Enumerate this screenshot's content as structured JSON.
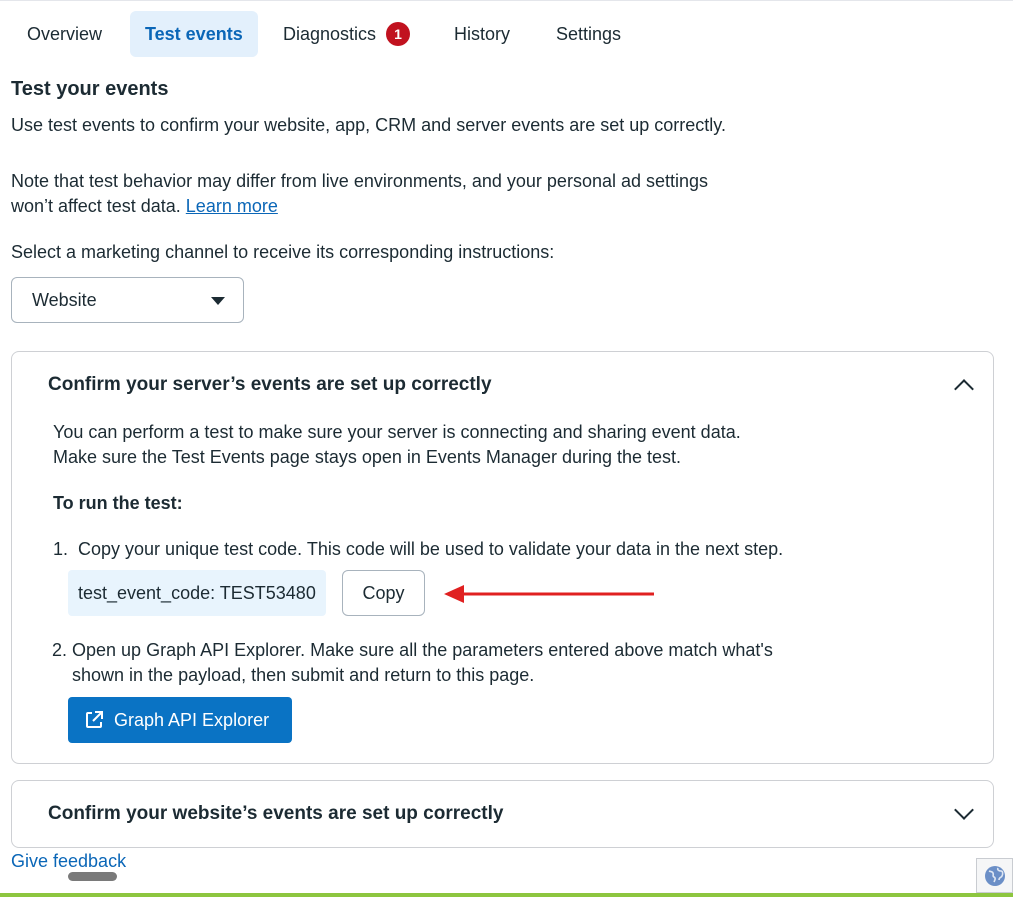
{
  "tabs": [
    {
      "label": "Overview",
      "active": false
    },
    {
      "label": "Test events",
      "active": true
    },
    {
      "label": "Diagnostics",
      "active": false,
      "badge": "1"
    },
    {
      "label": "History",
      "active": false
    },
    {
      "label": "Settings",
      "active": false
    }
  ],
  "intro": {
    "title": "Test your events",
    "line1": "Use test events to confirm your website, app, CRM and server events are set up correctly.",
    "note_line1": "Note that test behavior may differ from live environments, and your personal ad settings",
    "note_line2": "won’t affect test data.",
    "learn_more": "Learn more",
    "select_prompt": "Select a marketing channel to receive its corresponding instructions:"
  },
  "channel_select": {
    "value": "Website"
  },
  "server_card": {
    "title": "Confirm your server’s events are set up correctly",
    "desc_line1": "You can perform a test to make sure your server is connecting and sharing event data.",
    "desc_line2": "Make sure the Test Events page stays open in Events Manager during the test.",
    "run_heading": "To run the test:",
    "step1": "1.  Copy your unique test code. This code will be used to validate your data in the next step.",
    "test_code": "test_event_code: TEST53480",
    "copy_label": "Copy",
    "step2_line1": "2. Open up Graph API Explorer. Make sure all the parameters entered above match what's",
    "step2_line2": "shown in the payload, then submit and return to this page.",
    "api_button": "Graph API Explorer"
  },
  "website_card": {
    "title": "Confirm your website’s events are set up correctly"
  },
  "footer": {
    "feedback": "Give feedback"
  },
  "colors": {
    "accent": "#0a66b7",
    "primary_button": "#0a73c4",
    "badge": "#c1121f",
    "arrow": "#e02020",
    "code_bg": "#e8f4fd",
    "bottom_line": "#8dc63f"
  },
  "icons": [
    "chevron-down-icon",
    "chevron-up-icon",
    "external-link-icon",
    "globe-icon",
    "red-arrow-icon"
  ]
}
